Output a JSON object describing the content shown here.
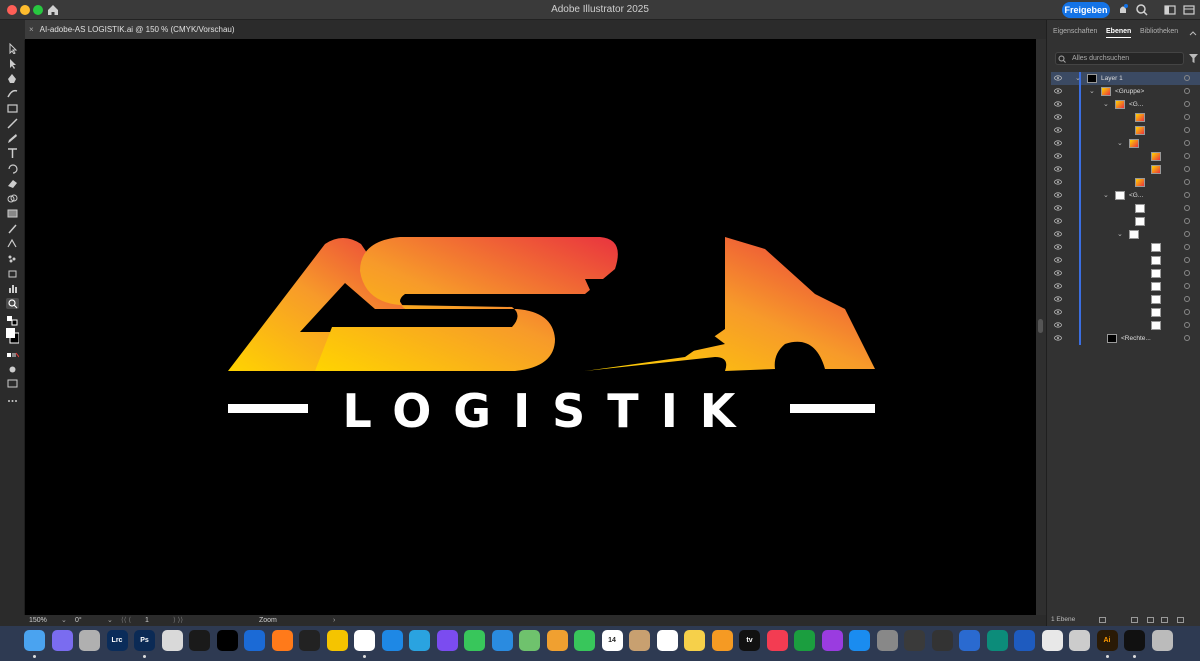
{
  "titlebar": {
    "app_title": "Adobe Illustrator 2025",
    "share_label": "Freigeben"
  },
  "document": {
    "tab_label": "AI-adobe-AS LOGISTIK.ai @ 150 % (CMYK/Vorschau)",
    "close_glyph": "×"
  },
  "artwork": {
    "line1": "AS",
    "line2": "LOGISTIK",
    "colors": {
      "gradient_start": "#FFD400",
      "gradient_mid": "#F79A2A",
      "gradient_end": "#E9333F",
      "text": "#FFFFFF",
      "background": "#000000"
    }
  },
  "statusbar": {
    "zoom": "150%",
    "rotation": "0°",
    "artboard": "1",
    "tool_label": "Zoom"
  },
  "panel": {
    "tabs": [
      "Eigenschaften",
      "Ebenen",
      "Bibliotheken"
    ],
    "active_tab": "Ebenen",
    "search_placeholder": "Alles durchsuchen",
    "layers": [
      {
        "name": "Layer 1",
        "thumb": "black"
      },
      {
        "name": "<Gruppe>",
        "thumb": "logo"
      },
      {
        "name": "<G...",
        "thumb": "logo"
      },
      {
        "name": "",
        "thumb": "logo"
      },
      {
        "name": "",
        "thumb": "logo"
      },
      {
        "name": "",
        "thumb": "logo"
      },
      {
        "name": "",
        "thumb": "logo"
      },
      {
        "name": "",
        "thumb": "logo"
      },
      {
        "name": "",
        "thumb": "logo"
      },
      {
        "name": "<G...",
        "thumb": "white"
      },
      {
        "name": "",
        "thumb": "white"
      },
      {
        "name": "",
        "thumb": "white"
      },
      {
        "name": "",
        "thumb": "white"
      },
      {
        "name": "",
        "thumb": "white"
      },
      {
        "name": "",
        "thumb": "white"
      },
      {
        "name": "",
        "thumb": "white"
      },
      {
        "name": "",
        "thumb": "white"
      },
      {
        "name": "",
        "thumb": "white"
      },
      {
        "name": "",
        "thumb": "white"
      },
      {
        "name": "",
        "thumb": "white"
      },
      {
        "name": "<Rechte...",
        "thumb": "black"
      }
    ],
    "footer_label": "1 Ebene"
  },
  "dock": {
    "apps": [
      "Finder",
      "Launchpad",
      "Photos",
      "Lightroom Classic",
      "Photoshop",
      "Stack",
      "DaVinci Resolve",
      "CapCut",
      "TeamViewer",
      "Firefox",
      "Activity Monitor",
      "Sticky",
      "Chrome",
      "Safari",
      "Telegram",
      "Messenger",
      "Messages",
      "Mail",
      "Maps",
      "Photos",
      "FaceTime",
      "Calendar",
      "Contacts",
      "Reminders",
      "Notes",
      "Pages",
      "Apple TV",
      "Music",
      "Numbers",
      "Podcasts",
      "App Store",
      "System Settings",
      "Monitor",
      "Screenshot",
      "Instruments",
      "Finder Helper",
      "Word",
      "Preview",
      "Image Capture",
      "Illustrator",
      "Terminal",
      "Trash"
    ],
    "calendar_date": "14",
    "labels": {
      "lrc": "Lrc",
      "ps": "Ps",
      "ai": "Ai",
      "tv": "tv"
    }
  }
}
